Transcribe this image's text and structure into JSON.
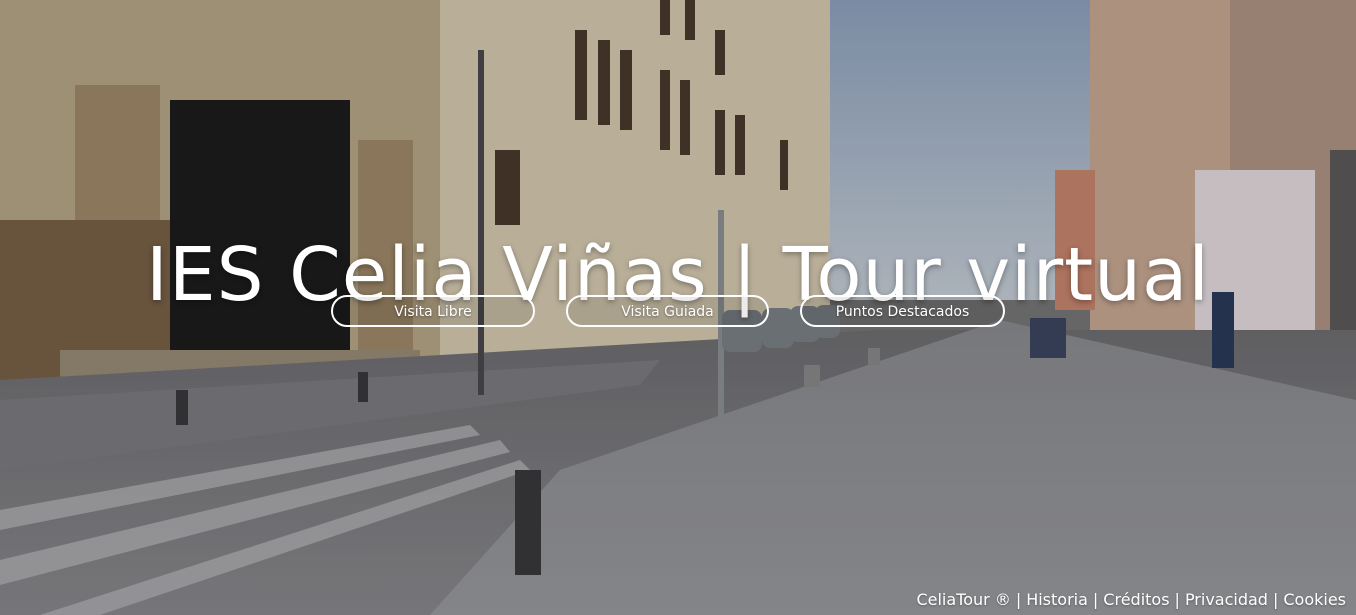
{
  "hero": {
    "title": "IES Celia Viñas | Tour virtual"
  },
  "nav_buttons": [
    {
      "label": "Visita Libre"
    },
    {
      "label": "Visita Guiada"
    },
    {
      "label": "Puntos Destacados"
    }
  ],
  "footer": {
    "brand": "CeliaTour ®",
    "separator": "|",
    "links": [
      {
        "label": "Historia"
      },
      {
        "label": "Créditos"
      },
      {
        "label": "Privacidad"
      },
      {
        "label": "Cookies"
      }
    ]
  },
  "colors": {
    "text": "#ffffff",
    "button_border": "#ffffff"
  }
}
